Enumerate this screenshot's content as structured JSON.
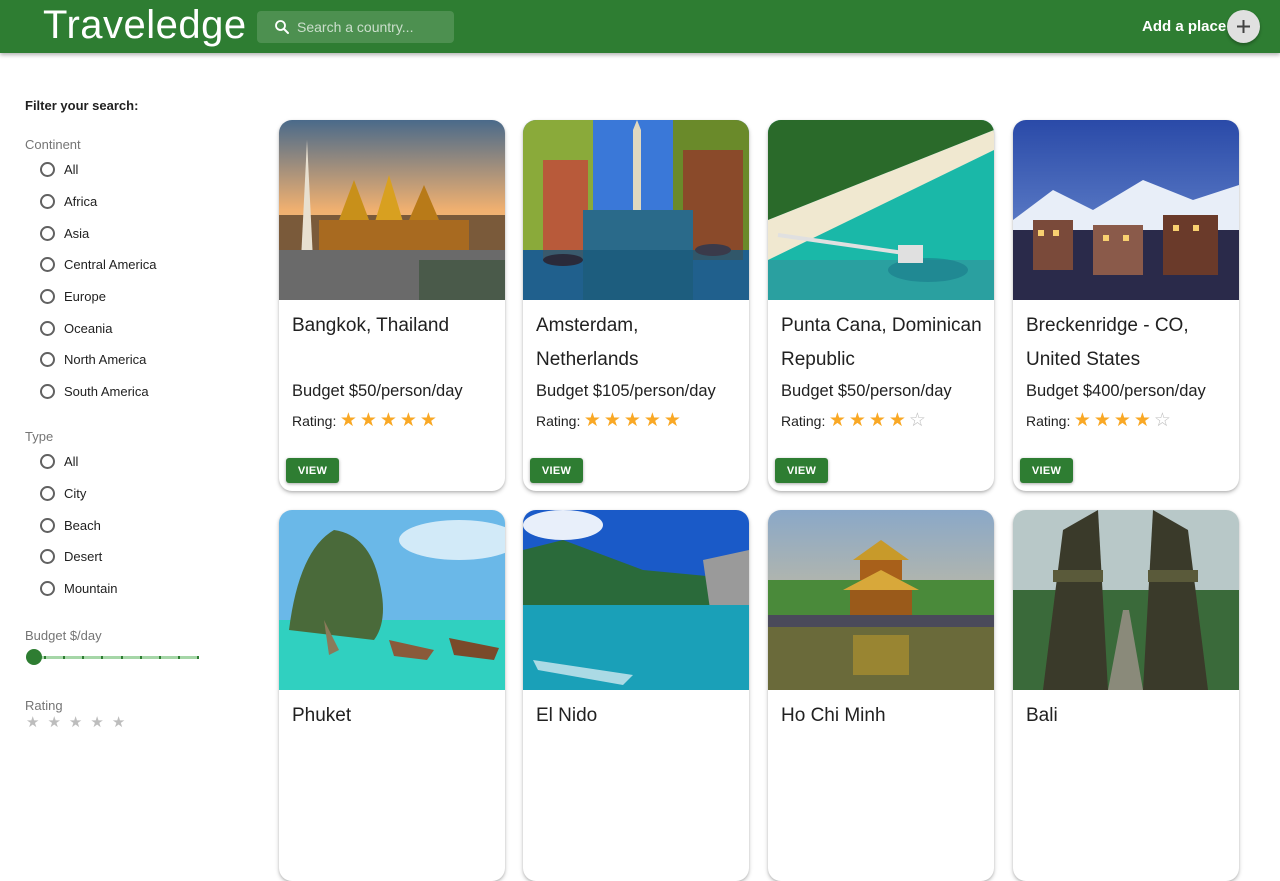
{
  "header": {
    "logo": "Traveledge",
    "search_placeholder": "Search a country...",
    "add_label": "Add a place",
    "brand_color": "#2e7d32"
  },
  "sidebar": {
    "title": "Filter your search:",
    "continent": {
      "label": "Continent",
      "options": [
        "All",
        "Africa",
        "Asia",
        "Central America",
        "Europe",
        "Oceania",
        "North America",
        "South America"
      ]
    },
    "type": {
      "label": "Type",
      "options": [
        "All",
        "City",
        "Beach",
        "Desert",
        "Mountain"
      ]
    },
    "budget": {
      "label": "Budget $/day",
      "value_fraction": 0
    },
    "rating": {
      "label": "Rating"
    }
  },
  "places": [
    {
      "title": "Bangkok, Thailand",
      "budget": "Budget $50/person/day",
      "rating_label": "Rating:",
      "rating": 5,
      "button": "VIEW",
      "image": "temple-skyline"
    },
    {
      "title": "Amsterdam, Netherlands",
      "budget": "Budget $105/person/day",
      "rating_label": "Rating:",
      "rating": 5,
      "button": "VIEW",
      "image": "canal"
    },
    {
      "title": "Punta Cana, Dominican Republic",
      "budget": "Budget $50/person/day",
      "rating_label": "Rating:",
      "rating": 4,
      "button": "VIEW",
      "image": "beach-aerial"
    },
    {
      "title": "Breckenridge - CO, United States",
      "budget": "Budget $400/person/day",
      "rating_label": "Rating:",
      "rating": 4,
      "button": "VIEW",
      "image": "mountain-town"
    },
    {
      "title": "Phuket",
      "image": "limestone-island"
    },
    {
      "title": "El Nido",
      "image": "lagoon"
    },
    {
      "title": "Ho Chi Minh",
      "image": "pagoda"
    },
    {
      "title": "Bali",
      "image": "temple-gate"
    }
  ]
}
